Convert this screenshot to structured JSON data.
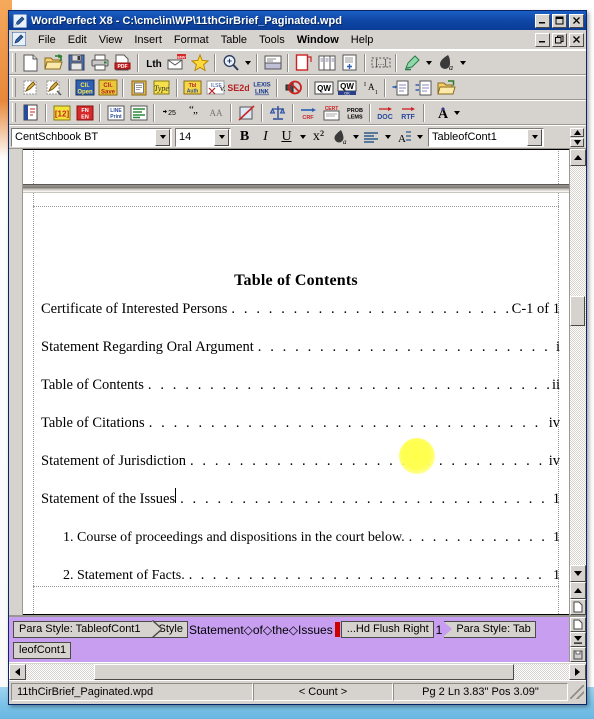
{
  "window": {
    "title": "WordPerfect X8 - C:\\cmc\\in\\WP\\11thCirBrief_Paginated.wpd",
    "app_icon": "wordperfect-pen-icon",
    "title_buttons": [
      {
        "name": "minimize",
        "glyph": "_"
      },
      {
        "name": "maximize",
        "glyph": "❐"
      },
      {
        "name": "close",
        "glyph": "✕"
      }
    ],
    "document_buttons": [
      {
        "name": "minimize",
        "glyph": "_"
      },
      {
        "name": "restore",
        "glyph": "❐"
      },
      {
        "name": "close",
        "glyph": "✕"
      }
    ]
  },
  "menu": {
    "doc_icon": "document-control-icon",
    "items": [
      {
        "label": "File",
        "active": false
      },
      {
        "label": "Edit",
        "active": false
      },
      {
        "label": "View",
        "active": false
      },
      {
        "label": "Insert",
        "active": false
      },
      {
        "label": "Format",
        "active": false
      },
      {
        "label": "Table",
        "active": false
      },
      {
        "label": "Tools",
        "active": false
      },
      {
        "label": "Window",
        "active": true
      },
      {
        "label": "Help",
        "active": false
      }
    ]
  },
  "toolbar_main": {
    "buttons": [
      {
        "name": "new-document-icon",
        "label": "New"
      },
      {
        "name": "open-document-icon",
        "label": "Open"
      },
      {
        "name": "save-document-icon",
        "label": "Save"
      },
      {
        "name": "print-icon",
        "label": "Print"
      },
      {
        "name": "publish-pdf-icon",
        "label": "PDF"
      },
      {
        "name": "letterhead-icon",
        "label": "Lth"
      },
      {
        "name": "envelope-icon",
        "label": "ENV"
      },
      {
        "name": "favorites-star-icon",
        "label": "Favorites"
      },
      {
        "name": "zoom-icon",
        "label": "Zoom"
      },
      {
        "name": "reveal-codes-icon",
        "label": "Reveal Codes"
      },
      {
        "name": "page-border-icon",
        "label": "Border"
      },
      {
        "name": "columns-icon",
        "label": "Columns"
      },
      {
        "name": "insert-page-icon",
        "label": "Insert Page"
      },
      {
        "name": "comment-icon",
        "label": "Comment"
      },
      {
        "name": "highlighter-icon",
        "label": "Highlight"
      },
      {
        "name": "font-color-icon",
        "label": "Font Color"
      }
    ]
  },
  "toolbar_legal": {
    "buttons": [
      {
        "name": "macro-play-icon",
        "label": "Play Macro"
      },
      {
        "name": "macro-edit-icon",
        "label": "Edit Macro"
      },
      {
        "name": "client-open-icon",
        "label": "Cli. Open"
      },
      {
        "name": "client-save-icon",
        "label": "Cli. Save"
      },
      {
        "name": "clipboard-icon",
        "label": "Clipboard"
      },
      {
        "name": "typeset-icon",
        "label": "Type"
      },
      {
        "name": "table-authorities-icon",
        "label": "ToA"
      },
      {
        "name": "westlaw-icon",
        "label": "W2"
      },
      {
        "name": "se2d-citation-icon",
        "label": "SE2d"
      },
      {
        "name": "lexis-link-icon",
        "label": "LEXIS LINK"
      },
      {
        "name": "mute-sound-icon",
        "label": "Sound"
      },
      {
        "name": "quickwords-icon",
        "label": "QW"
      },
      {
        "name": "quickwords-ok-icon",
        "label": "QW OK"
      },
      {
        "name": "superscript-icon",
        "label": "Superscript"
      },
      {
        "name": "indent-icon",
        "label": "Indent"
      },
      {
        "name": "hanging-indent-icon",
        "label": "Hanging Indent"
      },
      {
        "name": "open-folder-icon",
        "label": "Open Folder"
      }
    ]
  },
  "toolbar_brief": {
    "buttons": [
      {
        "name": "book-brief-icon",
        "label": "Brief"
      },
      {
        "name": "numbering-icon",
        "label": "[12]"
      },
      {
        "name": "footnote-endnote-icon",
        "label": "FN EN"
      },
      {
        "name": "line-print-icon",
        "label": "Line Print"
      },
      {
        "name": "paragraph-marks-icon",
        "label": "Codes"
      },
      {
        "name": "line-numbering-icon",
        "label": "25"
      },
      {
        "name": "quotation-icon",
        "label": "Quote"
      },
      {
        "name": "small-caps-icon",
        "label": "AA"
      },
      {
        "name": "strikeout-icon",
        "label": "Strikeout"
      },
      {
        "name": "justice-scales-icon",
        "label": "Scales"
      },
      {
        "name": "cross-reference-icon",
        "label": "CRF"
      },
      {
        "name": "certificate-icon",
        "label": "CERT"
      },
      {
        "name": "problems-icon",
        "label": "PROB LEMS"
      },
      {
        "name": "save-as-doc-icon",
        "label": "DOC"
      },
      {
        "name": "save-as-rtf-icon",
        "label": "RTF"
      },
      {
        "name": "font-effects-icon",
        "label": "Font Effects"
      }
    ]
  },
  "property_bar": {
    "font_name": "CentSchbook BT",
    "font_size": "14",
    "bold_label": "B",
    "italic_label": "I",
    "underline_label": "U",
    "superscript_label": "x²",
    "font_color_label": "Font Color",
    "justification_label": "Justification",
    "line_spacing_label": "Line Spacing",
    "style_name": "TableofCont1"
  },
  "document": {
    "heading": "Table of Contents",
    "entries": [
      {
        "text": "Certificate of Interested Persons",
        "page": "C-1 of 1",
        "sub": false
      },
      {
        "text": "Statement Regarding Oral Argument",
        "page": "i",
        "sub": false
      },
      {
        "text": "Table of Contents",
        "page": "ii",
        "sub": false
      },
      {
        "text": "Table of Citations",
        "page": "iv",
        "sub": false
      },
      {
        "text": "Statement of Jurisdiction",
        "page": "iv",
        "sub": false
      },
      {
        "text": "Statement of the Issues",
        "page": "1",
        "sub": false,
        "caret": true
      },
      {
        "text": "1.  Course of proceedings and dispositions in the court below.",
        "page": "1",
        "sub": true
      },
      {
        "text": "2.  Statement of Facts.",
        "page": "1",
        "sub": true
      }
    ],
    "leader_char": ".",
    "annotation": {
      "name": "cursor-highlight-blob",
      "color": "#ffff4d"
    }
  },
  "reveal_codes": {
    "row1": [
      {
        "kind": "para-style",
        "label": "Para Style: TableofCont1"
      },
      {
        "kind": "square",
        "label": "Style"
      },
      {
        "kind": "text",
        "label": "Statement◇of◇the◇Issues"
      },
      {
        "kind": "caret",
        "label": ""
      },
      {
        "kind": "square",
        "label": "...Hd Flush Right"
      },
      {
        "kind": "plain",
        "label": "1"
      },
      {
        "kind": "para-style-end",
        "label": "Para Style: Tab"
      }
    ],
    "row2": [
      {
        "kind": "square",
        "label": "leofCont1"
      }
    ]
  },
  "status_bar": {
    "filename": "11thCirBrief_Paginated.wpd",
    "count": "< Count >",
    "position": "Pg 2 Ln 3.83\" Pos 3.09\""
  },
  "colors": {
    "titlebar": "#0a3c96",
    "chrome": "#d6d3ce",
    "reveal_codes_bg": "#c79ef0",
    "caret_red": "#cc0000",
    "highlight_yellow": "#ffff4d"
  }
}
